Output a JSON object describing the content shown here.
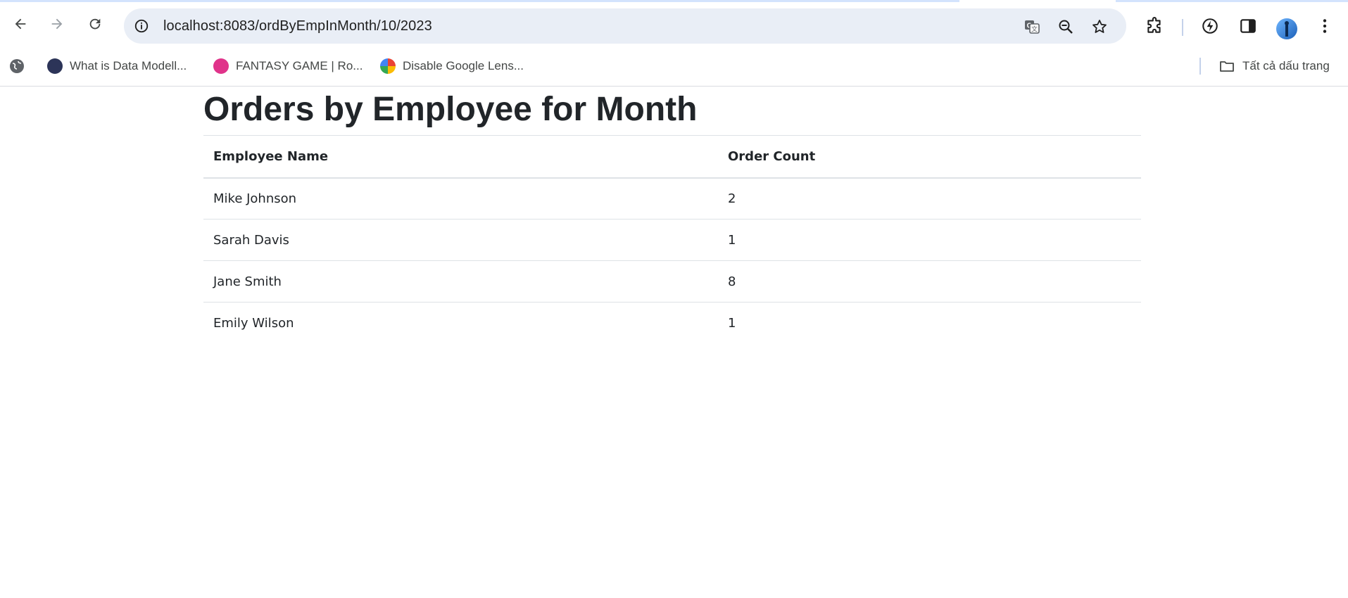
{
  "browser": {
    "url": "localhost:8083/ordByEmpInMonth/10/2023",
    "accent": "#d3e3fd",
    "omnibox_bg": "#e9eef6",
    "icons": {
      "back": "arrow-left-icon",
      "forward": "arrow-right-icon",
      "reload": "reload-icon",
      "info": "info-icon",
      "translate": "translate-icon",
      "zoom": "zoom-out-icon",
      "bookmark": "star-icon",
      "extensions": "puzzle-icon",
      "performance": "leaf-icon",
      "side_panel": "side-panel-icon",
      "profile": "avatar-icon",
      "menu": "kebab-menu-icon"
    }
  },
  "bookmarks": {
    "items": [
      {
        "label": "What is Data Modell...",
        "icon": "data-modelling-favicon"
      },
      {
        "label": "FANTASY GAME | Ro...",
        "icon": "fantasy-game-favicon"
      },
      {
        "label": "Disable Google Lens...",
        "icon": "rainbow-favicon"
      }
    ],
    "all_bookmarks_label": "Tất cả dấu trang"
  },
  "page": {
    "title": "Orders by Employee for Month",
    "table": {
      "headers": [
        "Employee Name",
        "Order Count"
      ],
      "rows": [
        [
          "Mike Johnson",
          "2"
        ],
        [
          "Sarah Davis",
          "1"
        ],
        [
          "Jane Smith",
          "8"
        ],
        [
          "Emily Wilson",
          "1"
        ]
      ]
    }
  }
}
